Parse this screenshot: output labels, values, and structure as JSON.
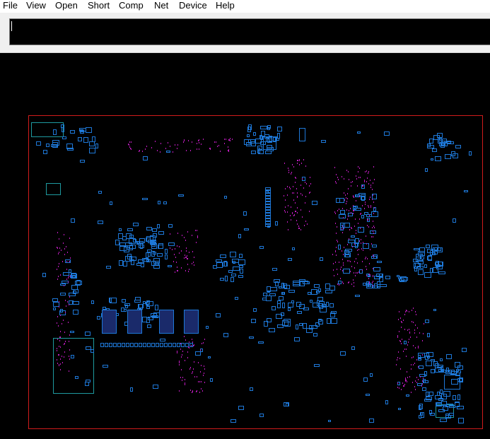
{
  "menu": {
    "file": "File",
    "view": "View",
    "open": "Open",
    "short": "Short",
    "comp": "Comp",
    "net": "Net",
    "device": "Device",
    "help": "Help"
  },
  "command_input": {
    "value": "",
    "placeholder": ""
  },
  "colors": {
    "background": "#000000",
    "board_outline": "#d01c1c",
    "component": "#1e78d8",
    "component_fill": "#1a2a6a",
    "pad": "#c01cc0",
    "large_footprint": "#1e9aa0",
    "menubar": "#ffffff",
    "toolbar": "#f0f0f0"
  },
  "icons": {
    "text_cursor": "text-caret-icon"
  }
}
